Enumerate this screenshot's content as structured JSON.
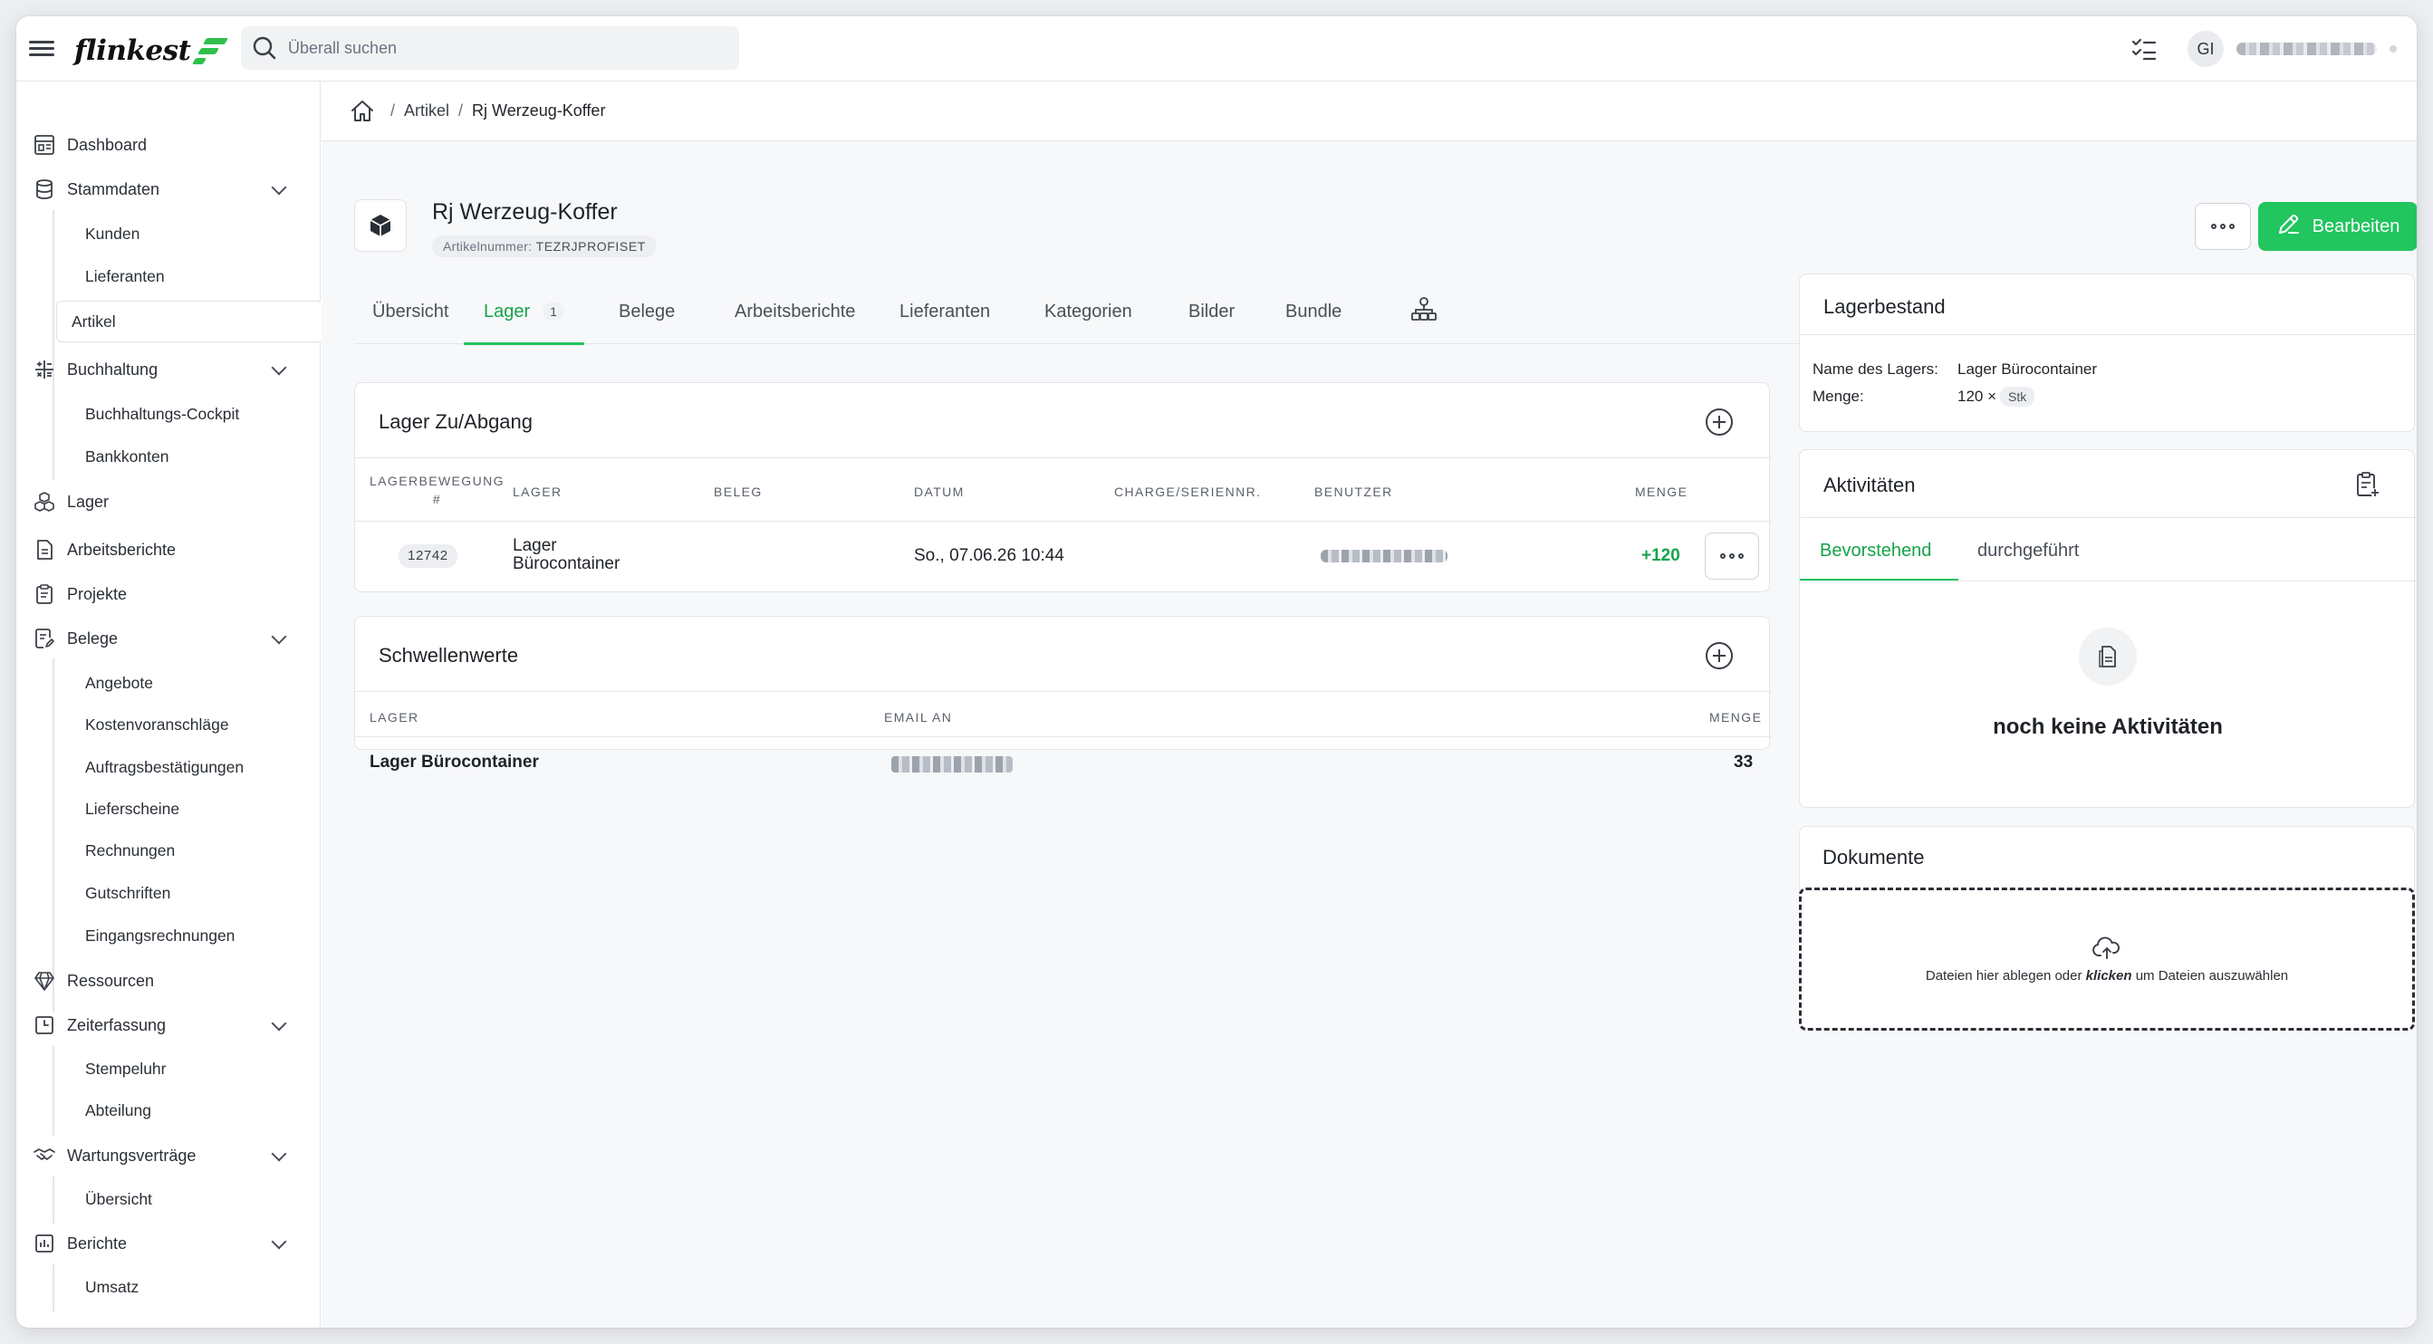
{
  "app": {
    "logo_text": "flinkest"
  },
  "search": {
    "placeholder": "Überall suchen"
  },
  "user": {
    "initials": "GI"
  },
  "sidebar": {
    "dashboard": "Dashboard",
    "stammdaten": "Stammdaten",
    "kunden": "Kunden",
    "lieferanten": "Lieferanten",
    "artikel": "Artikel",
    "buchhaltung": "Buchhaltung",
    "buchhaltungs_cockpit": "Buchhaltungs-Cockpit",
    "bankkonten": "Bankkonten",
    "lager": "Lager",
    "arbeitsberichte": "Arbeitsberichte",
    "projekte": "Projekte",
    "belege": "Belege",
    "angebote": "Angebote",
    "kostenvoranschlaege": "Kostenvoranschläge",
    "auftragsbestaetigungen": "Auftragsbestätigungen",
    "lieferscheine": "Lieferscheine",
    "rechnungen": "Rechnungen",
    "gutschriften": "Gutschriften",
    "eingangsrechnungen": "Eingangsrechnungen",
    "ressourcen": "Ressourcen",
    "zeiterfassung": "Zeiterfassung",
    "stempeluhr": "Stempeluhr",
    "abteilung": "Abteilung",
    "wartungsvertraege": "Wartungsverträge",
    "uebersicht": "Übersicht",
    "berichte": "Berichte",
    "umsatz": "Umsatz"
  },
  "breadcrumb": {
    "sep": "/",
    "parent": "Artikel",
    "current": "Rj Werzeug-Koffer"
  },
  "article": {
    "title": "Rj Werzeug-Koffer",
    "number_label": "Artikelnummer:",
    "number": "TEZRJPROFISET",
    "edit_label": "Bearbeiten"
  },
  "tabs": {
    "uebersicht": "Übersicht",
    "lager": "Lager",
    "lager_count": "1",
    "belege": "Belege",
    "arbeitsberichte": "Arbeitsberichte",
    "lieferanten": "Lieferanten",
    "kategorien": "Kategorien",
    "bilder": "Bilder",
    "bundle": "Bundle"
  },
  "lager_zu_abgang": {
    "title": "Lager Zu/Abgang",
    "columns": {
      "bewegung": "LAGERBEWEGUNG",
      "bewegung_hash": "#",
      "lager": "LAGER",
      "beleg": "BELEG",
      "datum": "DATUM",
      "charge": "CHARGE/SERIENNR.",
      "benutzer": "BENUTZER",
      "menge": "MENGE"
    },
    "row": {
      "id": "12742",
      "lager_line1": "Lager",
      "lager_line2": "Bürocontainer",
      "datum": "So., 07.06.26 10:44",
      "menge": "+120"
    }
  },
  "schwellenwerte": {
    "title": "Schwellenwerte",
    "columns": {
      "lager": "LAGER",
      "email": "EMAIL AN",
      "menge": "MENGE"
    },
    "row": {
      "lager": "Lager Bürocontainer",
      "menge": "33"
    }
  },
  "lagerbestand": {
    "title": "Lagerbestand",
    "name_label": "Name des Lagers:",
    "name_value": "Lager Bürocontainer",
    "menge_label": "Menge:",
    "menge_value": "120 ×",
    "unit": "Stk"
  },
  "aktivitaeten": {
    "title": "Aktivitäten",
    "tab_upcoming": "Bevorstehend",
    "tab_done": "durchgeführt",
    "empty": "noch keine Aktivitäten"
  },
  "dokumente": {
    "title": "Dokumente",
    "drop_pre": "Dateien hier ablegen oder",
    "drop_em": "klicken",
    "drop_post": "um Dateien auszuwählen"
  },
  "colors": {
    "accent": "#22c55e",
    "accent_text": "#16a34a"
  }
}
